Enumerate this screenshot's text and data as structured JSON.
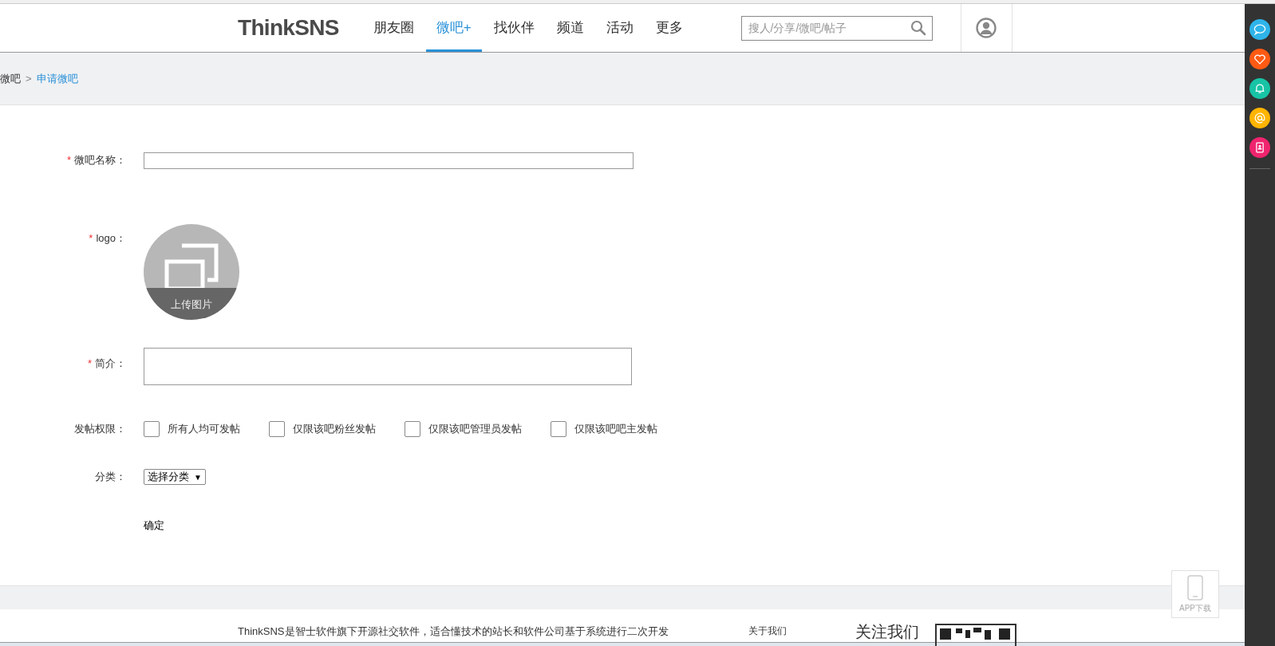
{
  "header": {
    "logo": "ThinkSNS",
    "nav": [
      {
        "label": "朋友圈",
        "selected": false
      },
      {
        "label": "微吧+",
        "selected": true
      },
      {
        "label": "找伙伴",
        "selected": false
      },
      {
        "label": "频道",
        "selected": false
      },
      {
        "label": "活动",
        "selected": false
      },
      {
        "label": "更多",
        "selected": false
      }
    ],
    "search": {
      "placeholder": "搜人/分享/微吧/帖子"
    }
  },
  "breadcrumb": [
    {
      "label": "微吧",
      "current": false
    },
    {
      "separator": ">"
    },
    {
      "label": "申请微吧",
      "current": true
    }
  ],
  "form": {
    "name_field": {
      "required_mark": "*",
      "label": "微吧名称："
    },
    "logo_field": {
      "required_mark": "*",
      "label": "logo：",
      "upload_label": "上传图片"
    },
    "intro_field": {
      "required_mark": "*",
      "label": "简介："
    },
    "post_permission": {
      "label": "发帖权限：",
      "options": [
        {
          "label": "所有人均可发帖",
          "checked": false
        },
        {
          "label": "仅限该吧粉丝发帖",
          "checked": false
        },
        {
          "label": "仅限该吧管理员发帖",
          "checked": false
        },
        {
          "label": "仅限该吧吧主发帖",
          "checked": false
        }
      ]
    },
    "category": {
      "label": "分类：",
      "value": "选择分类",
      "caret": "▼"
    },
    "submit": "确定"
  },
  "footer": {
    "description": "ThinkSNS是智士软件旗下开源社交软件，适合懂技术的站长和软件公司基于系统进行二次开发",
    "about": "关于我们",
    "follow": "关注我们"
  },
  "app_download": "APP下载",
  "side_bar": [
    {
      "kind": "chat",
      "color": "#2eb4ea"
    },
    {
      "kind": "heart",
      "color": "#ff5a14"
    },
    {
      "kind": "bell",
      "color": "#17c4a5"
    },
    {
      "kind": "at",
      "color": "#ffb400"
    },
    {
      "kind": "contacts",
      "color": "#f0246e"
    }
  ]
}
